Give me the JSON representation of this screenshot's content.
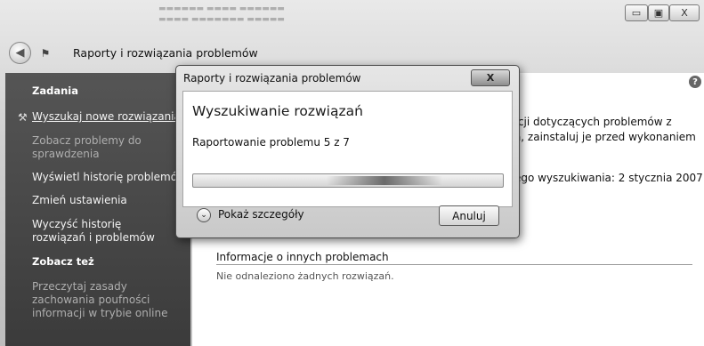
{
  "window": {
    "breadcrumb": "Raporty i rozwiązania problemów",
    "minimize_label": "▭",
    "maximize_label": "▣",
    "close_label": "X"
  },
  "sidebar": {
    "tasks_heading": "Zadania",
    "items": [
      {
        "label": "Wyszukaj nowe rozwiązania"
      },
      {
        "label": "Zobacz problemy do sprawdzenia"
      },
      {
        "label": "Wyświetl historię problemów"
      },
      {
        "label": "Zmień ustawienia"
      },
      {
        "label": "Wyczyść historię rozwiązań i problemów"
      }
    ],
    "see_also_heading": "Zobacz też",
    "see_also": [
      {
        "label": "Przeczytaj zasady zachowania poufności informacji w trybie online"
      }
    ]
  },
  "main": {
    "line1": "nacji dotyczących problemów z",
    "line2": "nia, zainstaluj je przed wykonaniem",
    "last_search": "niego wyszukiwania: 2 stycznia 2007",
    "section_title": "Informacje o innych problemach",
    "section_none": "Nie odnaleziono żadnych rozwiązań."
  },
  "dialog": {
    "title": "Raporty i rozwiązania problemów",
    "close_label": "X",
    "heading": "Wyszukiwanie rozwiązań",
    "status": "Raportowanie problemu 5 z 7",
    "details_label": "Pokaż szczegóły",
    "cancel_label": "Anuluj"
  },
  "icons": {
    "back": "back-arrow-icon",
    "forward": "forward-arrow-icon",
    "help": "help-icon",
    "search_task": "search-solutions-icon",
    "details": "chevron-down-icon"
  }
}
